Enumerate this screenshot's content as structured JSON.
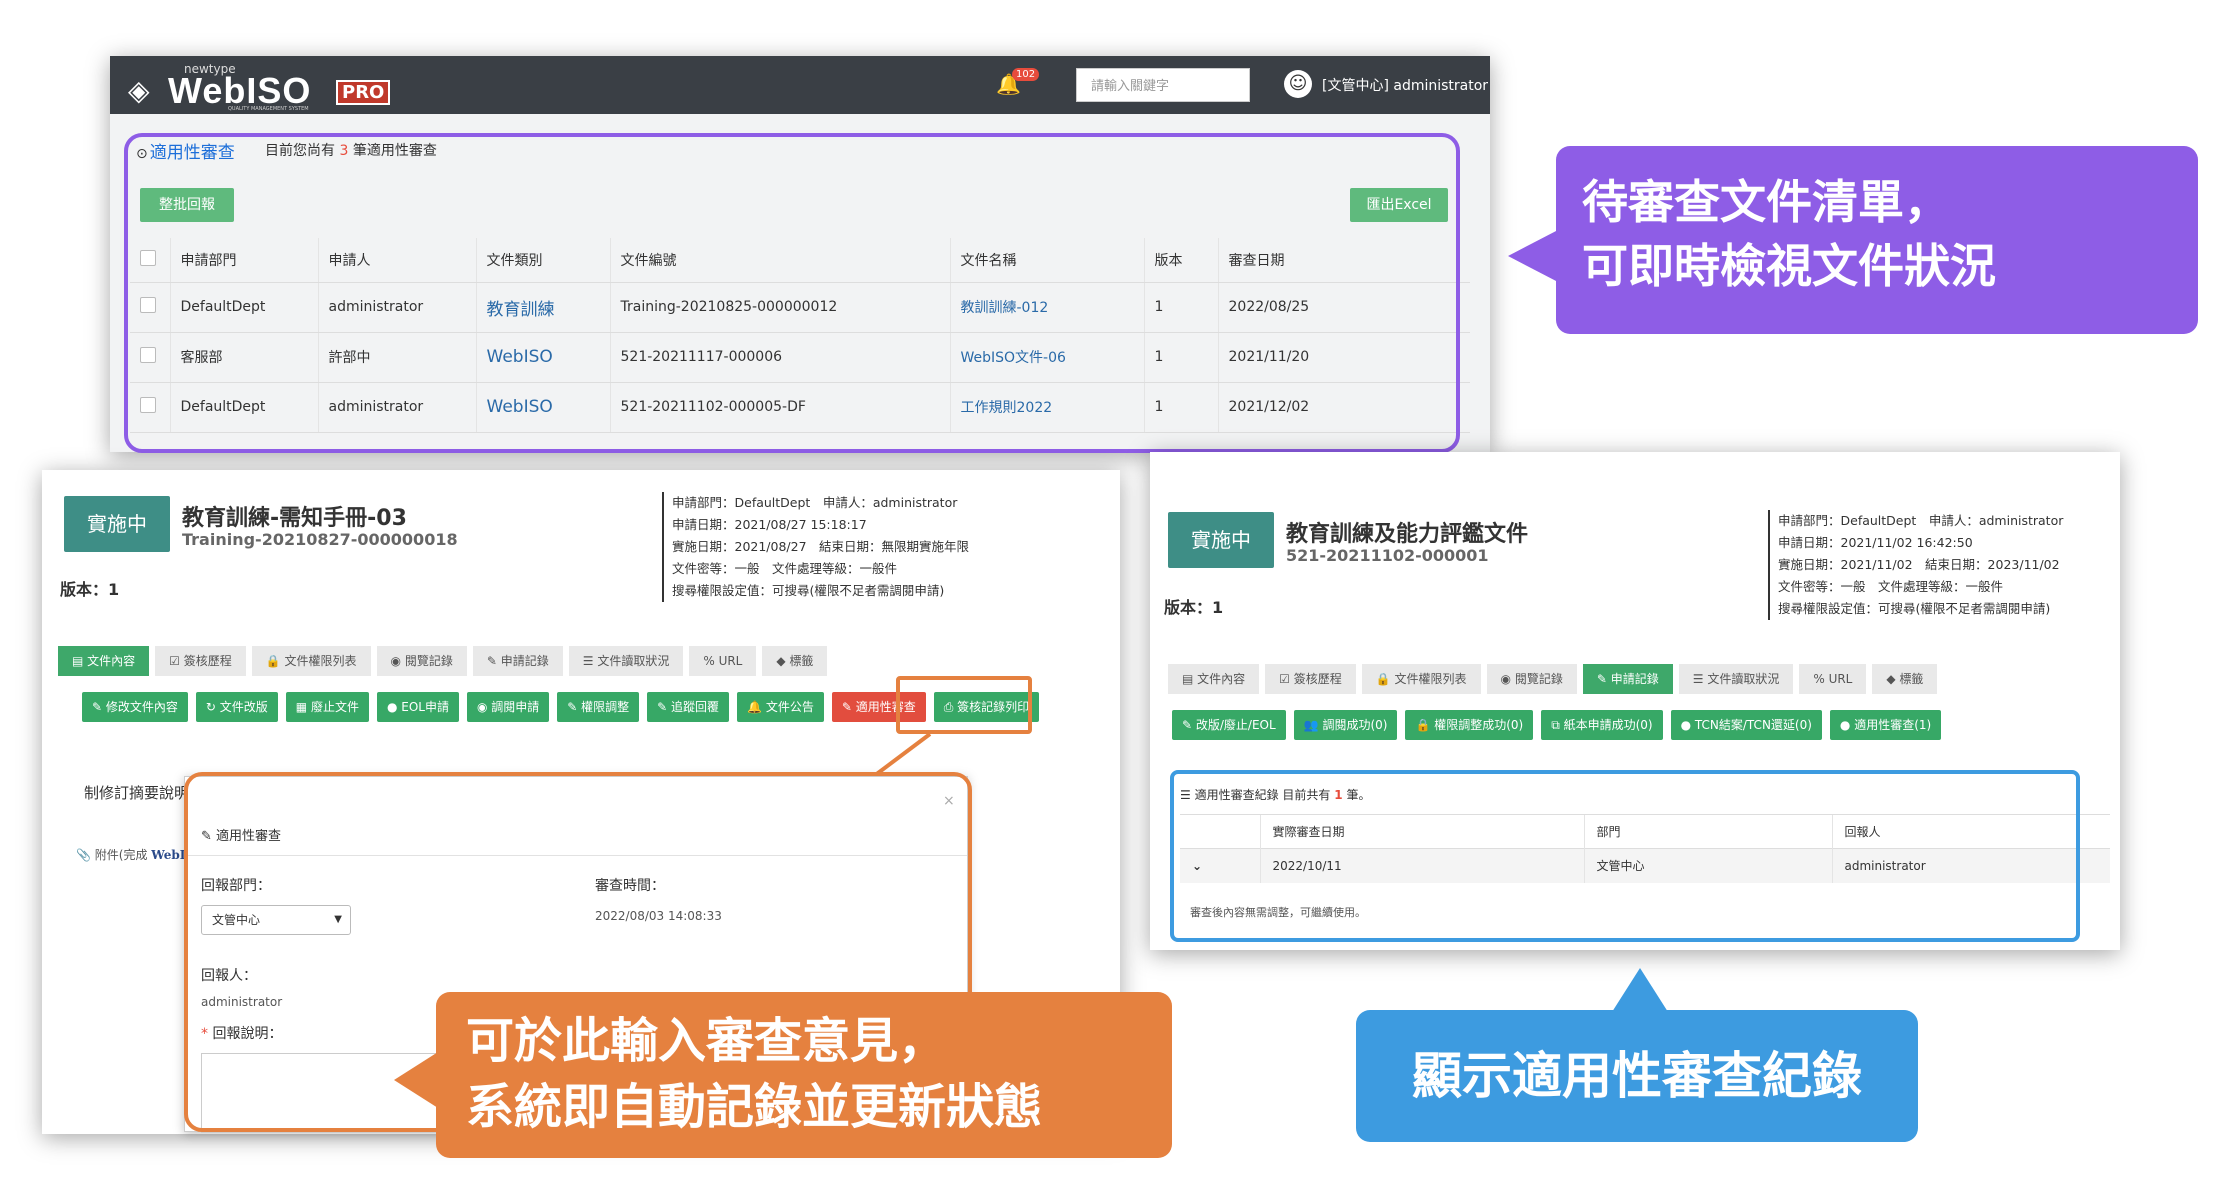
{
  "topbar": {
    "logo_small": "newtype",
    "logo_brand": "WebISO",
    "logo_pro": "PRO",
    "logo_sub": "QUALITY MANAGEMENT SYSTEM",
    "bell_count": "102",
    "search_placeholder": "請輸入關鍵字",
    "user": "[文管中心] administrator"
  },
  "list": {
    "title": "適用性審查",
    "subtitle_pre": "目前您尚有",
    "subtitle_count": "3",
    "subtitle_post": "筆適用性審查",
    "batch_button": "整批回報",
    "export_button": "匯出Excel",
    "columns": [
      "申請部門",
      "申請人",
      "文件類別",
      "文件編號",
      "文件名稱",
      "版本",
      "審查日期"
    ],
    "rows": [
      {
        "dept": "DefaultDept",
        "applicant": "administrator",
        "category": "教育訓練",
        "doc_no": "Training-20210825-000000012",
        "doc_name": "教訓訓練-012",
        "version": "1",
        "date": "2022/08/25"
      },
      {
        "dept": "客服部",
        "applicant": "許部中",
        "category": "WebISO",
        "doc_no": "521-20211117-000006",
        "doc_name": "WebISO文件-06",
        "version": "1",
        "date": "2021/11/20"
      },
      {
        "dept": "DefaultDept",
        "applicant": "administrator",
        "category": "WebISO",
        "doc_no": "521-20211102-000005-DF",
        "doc_name": "工作規則2022",
        "version": "1",
        "date": "2021/12/02"
      }
    ]
  },
  "callouts": {
    "purple_line1": "待審查文件清單，",
    "purple_line2": "可即時檢視文件狀況",
    "orange_line1": "可於此輸入審查意見，",
    "orange_line2": "系統即自動記錄並更新狀態",
    "blue": "顯示適用性審查紀錄"
  },
  "left_doc": {
    "status": "實施中",
    "title": "教育訓練-需知手冊-03",
    "code": "Training-20210827-000000018",
    "version": "版本：1",
    "meta": [
      "申請部門：DefaultDept　申請人：administrator",
      "申請日期：2021/08/27 15:18:17",
      "實施日期：2021/08/27　結束日期：無限期實施年限",
      "文件密等：一般　文件處理等級：一般件",
      "搜尋權限設定值：可搜尋(權限不足者需調閱申請)"
    ],
    "tabs": [
      "文件內容",
      "簽核歷程",
      "文件權限列表",
      "閱覽記錄",
      "申請記錄",
      "文件讀取狀況",
      "URL",
      "標籤"
    ],
    "actions": [
      "修改文件內容",
      "文件改版",
      "廢止文件",
      "EOL申請",
      "調閱申請",
      "權限調整",
      "追蹤回覆",
      "文件公告",
      "適用性審查",
      "簽核記錄列印"
    ],
    "revision_label": "制修訂摘要說明",
    "attach_label": "附件(完成",
    "attach_link": "WebI"
  },
  "modal": {
    "header": "適用性審查",
    "close": "×",
    "dept_label": "回報部門：",
    "dept_value": "文管中心",
    "time_label": "審查時間：",
    "time_value": "2022/08/03 14:08:33",
    "reporter_label": "回報人：",
    "reporter_value": "administrator",
    "note_required": "*",
    "note_label": "回報說明："
  },
  "right_doc": {
    "status": "實施中",
    "title": "教育訓練及能力評鑑文件",
    "code": "521-20211102-000001",
    "version": "版本：1",
    "meta": [
      "申請部門：DefaultDept　申請人：administrator",
      "申請日期：2021/11/02 16:42:50",
      "實施日期：2021/11/02　結束日期：2023/11/02",
      "文件密等：一般　文件處理等級：一般件",
      "搜尋權限設定值：可搜尋(權限不足者需調閱申請)"
    ],
    "tabs": [
      "文件內容",
      "簽核歷程",
      "文件權限列表",
      "閱覽記錄",
      "申請記錄",
      "文件讀取狀況",
      "URL",
      "標籤"
    ],
    "actions": [
      "改版/廢止/EOL",
      "調閱成功(0)",
      "權限調整成功(0)",
      "紙本申請成功(0)",
      "TCN結案/TCN還延(0)",
      "適用性審查(1)"
    ],
    "record_title": "適用性審查紀錄",
    "record_pre": "目前共有",
    "record_count": "1",
    "record_post": "筆。",
    "record_columns": [
      "實際審查日期",
      "部門",
      "回報人"
    ],
    "record_row": {
      "date": "2022/10/11",
      "dept": "文管中心",
      "reporter": "administrator"
    },
    "record_note": "審查後內容無需調整，可繼續使用。"
  },
  "colors": {
    "purple": "#8e5de6",
    "orange": "#e5813f",
    "blue": "#3d9be0",
    "green": "#37a866",
    "badge": "#3e8e86"
  }
}
